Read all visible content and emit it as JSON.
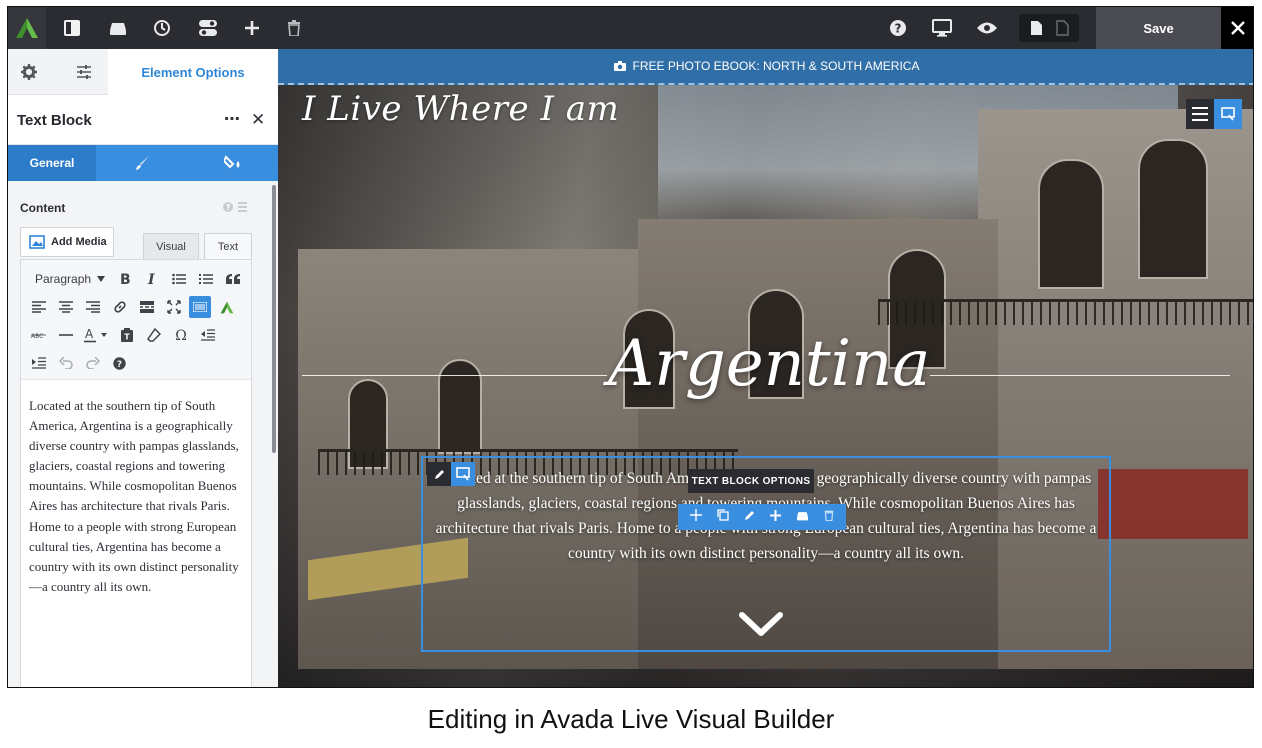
{
  "topbar": {
    "save_label": "Save"
  },
  "sidebar": {
    "tabs": {
      "element_options": "Element Options"
    },
    "panel_title": "Text Block",
    "more_icon": "⋯",
    "close_icon": "✕",
    "subtabs": {
      "general": "General"
    },
    "content_label": "Content",
    "add_media_label": "Add Media",
    "editor_tabs": {
      "visual": "Visual",
      "text": "Text"
    },
    "format_value": "Paragraph",
    "editor_text": "Located at the southern tip of South America, Argentina is a geographically diverse country with pampas glasslands, glaciers, coastal regions and towering mountains. While cosmopolitan Buenos Aires has architecture that rivals Paris. Home to a people with strong European cultural ties, Argentina has become a country with its own distinct personality—a country all its own."
  },
  "preview": {
    "banner_text": "FREE PHOTO EBOOK: NORTH & SOUTH AMERICA",
    "site_logo": "I Live Where I am",
    "hero_title": "Argentina",
    "hero_text": "Located at the southern tip of South America, Argentina is a geographically diverse country with pampas glasslands, glaciers, coastal regions and towering mountains. While cosmopolitan Buenos Aires has architecture that rivals Paris. Home to a people with strong European cultural ties, Argentina has become a country with its own distinct personality—a country all its own.",
    "text_block_options_label": "TEXT BLOCK OPTIONS"
  },
  "caption": "Editing in Avada Live Visual Builder",
  "colors": {
    "accent": "#3a8ee0",
    "toolbar_bg": "#2b2c31",
    "banner_bg": "#2f6ea6",
    "logo_green": "#4caf50"
  },
  "icons": [
    "avada-logo-icon",
    "page-layout-icon",
    "library-icon",
    "history-icon",
    "toggles-icon",
    "add-icon",
    "trash-icon",
    "help-icon",
    "desktop-icon",
    "preview-eye-icon",
    "page-icon",
    "camera-icon",
    "gear-icon",
    "sliders-icon",
    "brush-icon",
    "drop-icon",
    "chevron-down-icon"
  ]
}
